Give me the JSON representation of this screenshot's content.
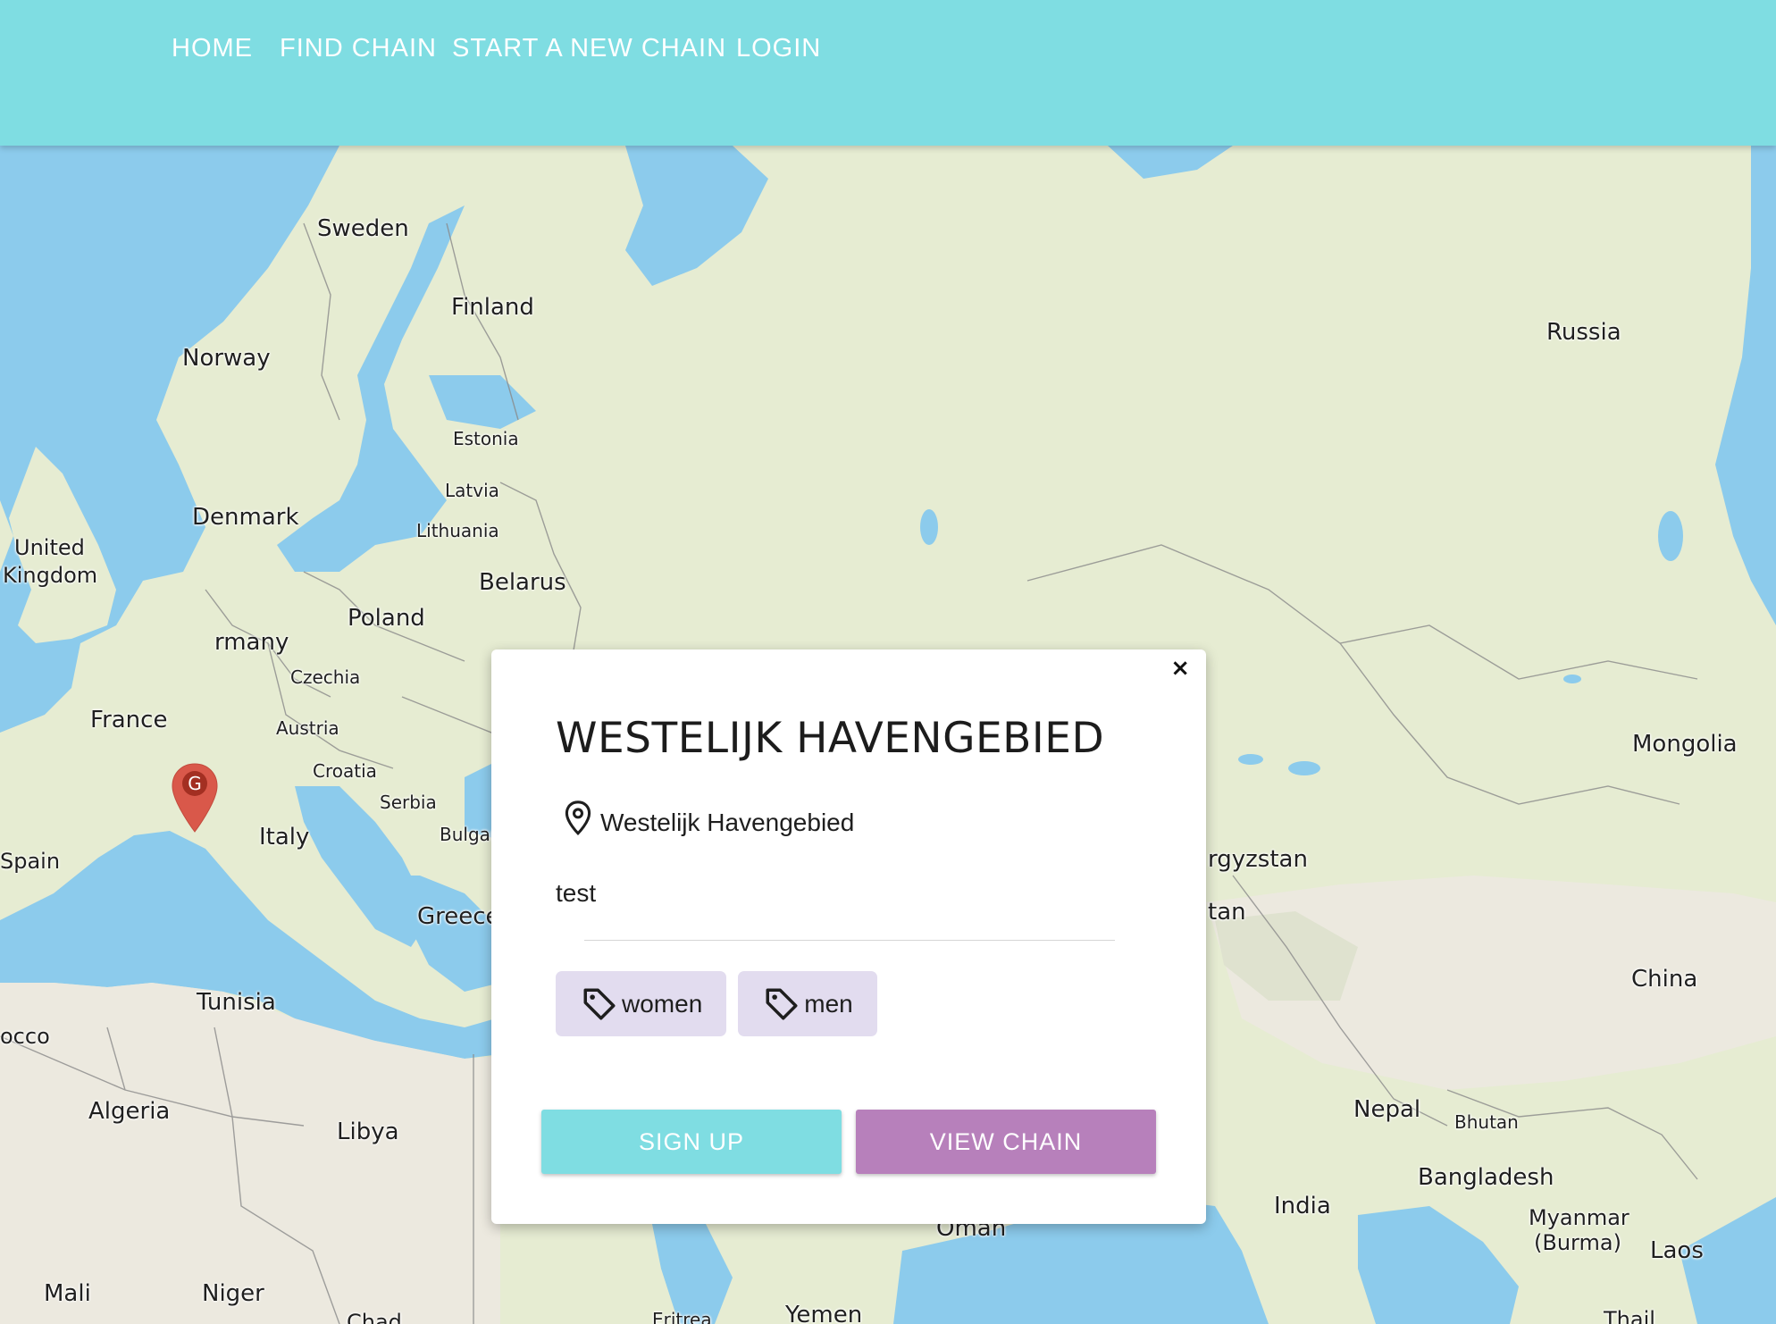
{
  "nav": {
    "home": "HOME",
    "find_chain": "FIND CHAIN",
    "start_chain": "START A NEW CHAIN",
    "login": "LOGIN"
  },
  "map": {
    "labels": {
      "sweden": "Sweden",
      "finland": "Finland",
      "russia": "Russia",
      "norway": "Norway",
      "estonia": "Estonia",
      "latvia": "Latvia",
      "lithuania": "Lithuania",
      "denmark": "Denmark",
      "united": "United",
      "kingdom": "Kingdom",
      "belarus": "Belarus",
      "poland": "Poland",
      "germany": "rmany",
      "czechia": "Czechia",
      "france": "France",
      "austria": "Austria",
      "croatia": "Croatia",
      "serbia": "Serbia",
      "bulgaria": "Bulgar",
      "italy": "Italy",
      "spain": "Spain",
      "greece": "Greece",
      "tunisia": "Tunisia",
      "morocco": "occo",
      "algeria": "Algeria",
      "libya": "Libya",
      "mali": "Mali",
      "niger": "Niger",
      "chad": "Chad",
      "eritrea": "Eritrea",
      "yemen": "Yemen",
      "oman": "Oman",
      "kyrgyzstan": "rgyzstan",
      "tajikistan": "tan",
      "mongolia": "Mongolia",
      "china": "China",
      "nepal": "Nepal",
      "bhutan": "Bhutan",
      "bangladesh": "Bangladesh",
      "india": "India",
      "myanmar": "Myanmar",
      "burma": "(Burma)",
      "laos": "Laos",
      "thailand": "Thail"
    },
    "marker_letter": "G",
    "colors": {
      "water": "#8ccbec",
      "land": "#e6ecd2",
      "desert": "#ece9df",
      "marker": "#d9584a"
    }
  },
  "popup": {
    "close": "×",
    "title": "WESTELIJK HAVENGEBIED",
    "location": "Westelijk Havengebied",
    "description": "test",
    "tags": [
      "women",
      "men"
    ],
    "signup_label": "SIGN UP",
    "view_label": "VIEW CHAIN"
  },
  "colors": {
    "navbar": "#7fdde2",
    "tag_bg": "#e2dcef",
    "signup_button": "#7fdde2",
    "view_button": "#b780bb"
  }
}
